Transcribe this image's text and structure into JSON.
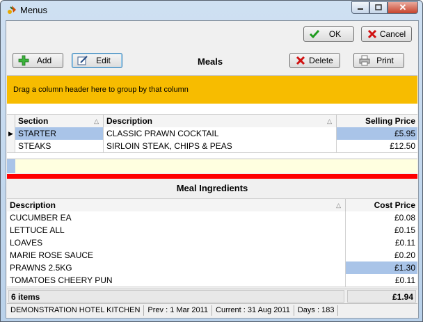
{
  "window": {
    "title": "Menus"
  },
  "buttons": {
    "ok": "OK",
    "cancel": "Cancel",
    "add": "Add",
    "edit": "Edit",
    "delete": "Delete",
    "print": "Print"
  },
  "meals": {
    "title": "Meals",
    "group_hint": "Drag a column header here to group by that column",
    "headers": {
      "section": "Section",
      "description": "Description",
      "price": "Selling Price"
    },
    "rows": [
      {
        "section": "STARTER",
        "description": "CLASSIC PRAWN COCKTAIL",
        "price": "£5.95"
      },
      {
        "section": "STEAKS",
        "description": "SIRLOIN STEAK, CHIPS & PEAS",
        "price": "£12.50"
      }
    ]
  },
  "ingredients": {
    "title": "Meal Ingredients",
    "headers": {
      "description": "Description",
      "cost": "Cost Price"
    },
    "rows": [
      {
        "description": "CUCUMBER  EA",
        "cost": "£0.08"
      },
      {
        "description": "LETTUCE ALL",
        "cost": "£0.15"
      },
      {
        "description": "LOAVES",
        "cost": "£0.11"
      },
      {
        "description": "MARIE ROSE SAUCE",
        "cost": "£0.20"
      },
      {
        "description": "PRAWNS 2.5KG",
        "cost": "£1.30"
      },
      {
        "description": "TOMATOES CHEERY PUN",
        "cost": "£0.11"
      }
    ],
    "footer": {
      "count": "6 items",
      "total": "£1.94"
    }
  },
  "status": {
    "site": "DEMONSTRATION HOTEL KITCHEN",
    "prev": "Prev : 1 Mar 2011",
    "current": "Current : 31 Aug 2011",
    "days": "Days : 183"
  },
  "colors": {
    "group_panel": "#f7bc00",
    "selection": "#a9c4e8",
    "divider": "#ff0000"
  }
}
